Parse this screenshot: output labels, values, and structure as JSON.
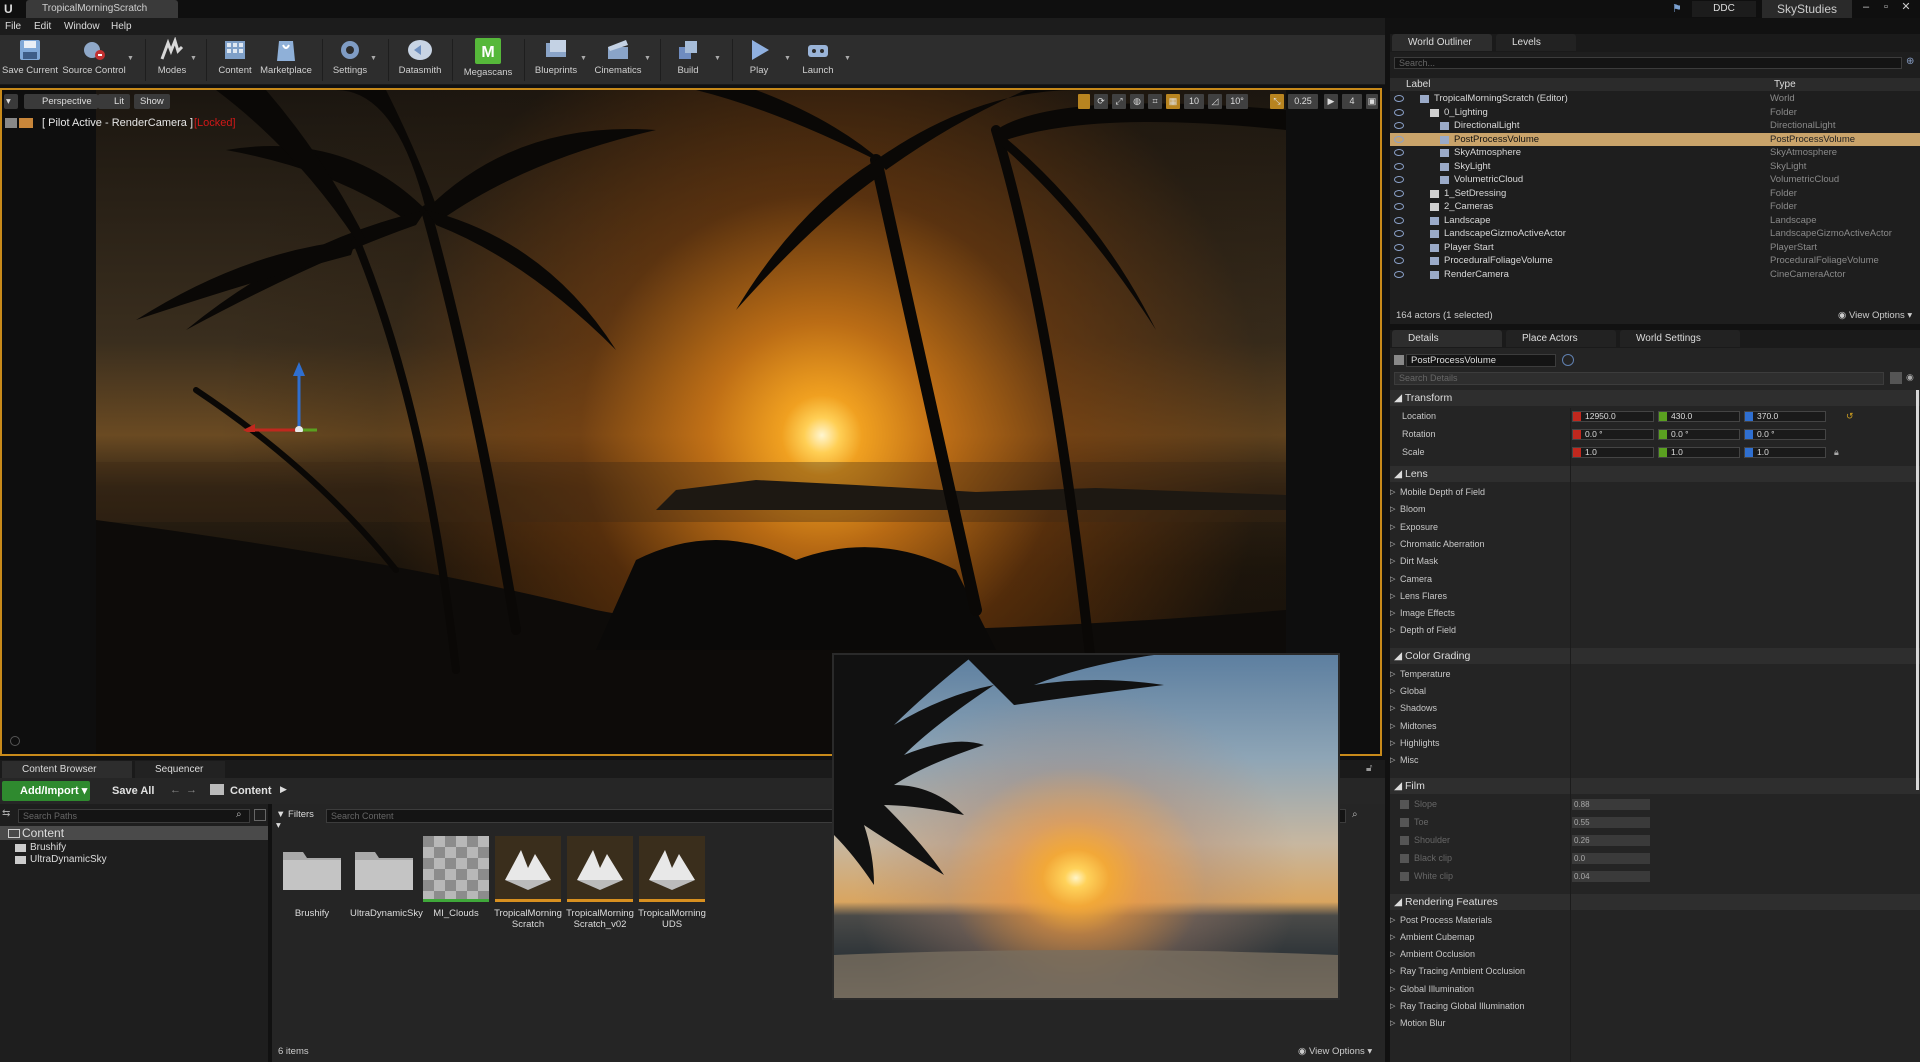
{
  "window": {
    "doc_tab": "TropicalMorningScratch",
    "ddc_tag": "DDC",
    "studio": "SkyStudies"
  },
  "menu": [
    "File",
    "Edit",
    "Window",
    "Help"
  ],
  "toolbar": [
    {
      "label": "Save Current",
      "icon": "save-icon"
    },
    {
      "label": "Source Control",
      "icon": "source-control-icon"
    },
    {
      "label": "Modes",
      "icon": "modes-icon"
    },
    {
      "label": "Content",
      "icon": "content-icon"
    },
    {
      "label": "Marketplace",
      "icon": "marketplace-icon"
    },
    {
      "label": "Settings",
      "icon": "settings-icon"
    },
    {
      "label": "Datasmith",
      "icon": "datasmith-icon"
    },
    {
      "label": "Megascans",
      "icon": "megascans-icon"
    },
    {
      "label": "Blueprints",
      "icon": "blueprints-icon"
    },
    {
      "label": "Cinematics",
      "icon": "cinematics-icon"
    },
    {
      "label": "Build",
      "icon": "build-icon"
    },
    {
      "label": "Play",
      "icon": "play-icon"
    },
    {
      "label": "Launch",
      "icon": "launch-icon"
    }
  ],
  "viewport": {
    "perspective": "Perspective",
    "lit": "Lit",
    "show": "Show",
    "camera_label": "[ Pilot Active - RenderCamera ]",
    "locked": "[Locked]",
    "snap_values": [
      "10",
      "10°",
      "0.25",
      "4"
    ]
  },
  "content_browser": {
    "tabs": [
      "Content Browser",
      "Sequencer"
    ],
    "add_import": "Add/Import",
    "save_all": "Save All",
    "path": "Content",
    "search_paths_placeholder": "Search Paths",
    "filters": "Filters",
    "search_content_placeholder": "Search Content",
    "tree": [
      "Content",
      "Brushify",
      "UltraDynamicSky"
    ],
    "assets": [
      {
        "name": "Brushify",
        "kind": "folder"
      },
      {
        "name": "UltraDynamicSky",
        "kind": "folder"
      },
      {
        "name": "MI_Clouds",
        "kind": "material"
      },
      {
        "name": "TropicalMorning Scratch",
        "kind": "level"
      },
      {
        "name": "TropicalMorning Scratch_v02",
        "kind": "level"
      },
      {
        "name": "TropicalMorning UDS",
        "kind": "level"
      }
    ],
    "item_count": "6 items",
    "view_options": "View Options"
  },
  "outliner": {
    "tabs": [
      "World Outliner",
      "Levels"
    ],
    "search_placeholder": "Search...",
    "col_label": "Label",
    "col_type": "Type",
    "rows": [
      {
        "label": "TropicalMorningScratch (Editor)",
        "type": "World",
        "indent": 0
      },
      {
        "label": "0_Lighting",
        "type": "Folder",
        "indent": 1
      },
      {
        "label": "DirectionalLight",
        "type": "DirectionalLight",
        "indent": 2
      },
      {
        "label": "PostProcessVolume",
        "type": "PostProcessVolume",
        "indent": 2,
        "selected": true
      },
      {
        "label": "SkyAtmosphere",
        "type": "SkyAtmosphere",
        "indent": 2
      },
      {
        "label": "SkyLight",
        "type": "SkyLight",
        "indent": 2
      },
      {
        "label": "VolumetricCloud",
        "type": "VolumetricCloud",
        "indent": 2
      },
      {
        "label": "1_SetDressing",
        "type": "Folder",
        "indent": 1
      },
      {
        "label": "2_Cameras",
        "type": "Folder",
        "indent": 1
      },
      {
        "label": "Landscape",
        "type": "Landscape",
        "indent": 1
      },
      {
        "label": "LandscapeGizmoActiveActor",
        "type": "LandscapeGizmoActiveActor",
        "indent": 1
      },
      {
        "label": "Player Start",
        "type": "PlayerStart",
        "indent": 1
      },
      {
        "label": "ProceduralFoliageVolume",
        "type": "ProceduralFoliageVolume",
        "indent": 1
      },
      {
        "label": "RenderCamera",
        "type": "CineCameraActor",
        "indent": 1
      }
    ],
    "actor_count": "164 actors (1 selected)",
    "view_options": "View Options"
  },
  "details": {
    "tabs": [
      "Details",
      "Place Actors",
      "World Settings"
    ],
    "object_name": "PostProcessVolume",
    "search_placeholder": "Search Details",
    "transform": {
      "title": "Transform",
      "location_label": "Location",
      "rotation_label": "Rotation",
      "scale_label": "Scale",
      "location": [
        "12950.0",
        "430.0",
        "370.0"
      ],
      "rotation": [
        "0.0 °",
        "0.0 °",
        "0.0 °"
      ],
      "scale": [
        "1.0",
        "1.0",
        "1.0"
      ]
    },
    "lens": {
      "title": "Lens",
      "items": [
        "Mobile Depth of Field",
        "Bloom",
        "Exposure",
        "Chromatic Aberration",
        "Dirt Mask",
        "Camera",
        "Lens Flares",
        "Image Effects",
        "Depth of Field"
      ]
    },
    "color_grading": {
      "title": "Color Grading",
      "items": [
        "Temperature",
        "Global",
        "Shadows",
        "Midtones",
        "Highlights",
        "Misc"
      ]
    },
    "film": {
      "title": "Film",
      "items": [
        {
          "name": "Slope",
          "value": "0.88"
        },
        {
          "name": "Toe",
          "value": "0.55"
        },
        {
          "name": "Shoulder",
          "value": "0.26"
        },
        {
          "name": "Black clip",
          "value": "0.0"
        },
        {
          "name": "White clip",
          "value": "0.04"
        }
      ]
    },
    "rendering_features": {
      "title": "Rendering Features",
      "items": [
        "Post Process Materials",
        "Ambient Cubemap",
        "Ambient Occlusion",
        "Ray Tracing Ambient Occlusion",
        "Global Illumination",
        "Ray Tracing Global Illumination",
        "Motion Blur"
      ]
    }
  },
  "colors": {
    "accent_orange": "#c88a1a",
    "add_green": "#2f8a2f",
    "selection": "#c9a36a",
    "locked_red": "#d01818",
    "axis_x": "#c0281e",
    "axis_y": "#5aa020",
    "axis_z": "#2f6fd0"
  }
}
